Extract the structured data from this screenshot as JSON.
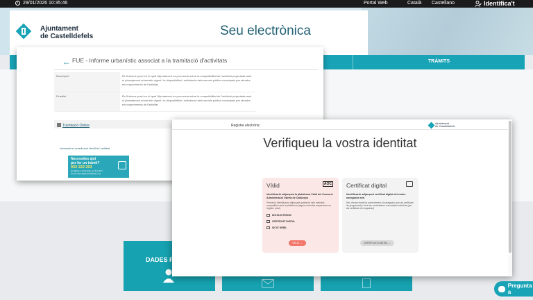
{
  "topbar": {
    "datetime": "29/01/2026 10:35:46",
    "links": [
      "Portal Web",
      "Català",
      "Castellano"
    ],
    "identify": "Identifica't"
  },
  "header": {
    "logo_line1": "Ajuntament",
    "logo_line2": "de Castelldefels",
    "site_title": "Seu electrònica"
  },
  "nav": {
    "tramits": "TRÀMITS"
  },
  "procedure": {
    "title": "FUE - Informe urbanístic associat a la tramitació d'activitats",
    "rows": [
      {
        "key": "Descripció",
        "value": "És l'informe previ en el qual l'Ajuntament es pronuncia sobre la compatibilitat de l'activitat projectada amb el planejament urbanístic vigent i la disponibilitat i suficiència dels serveis públics municipals per atendre els requeriments de l'activitat."
      },
      {
        "key": "Finalitat",
        "value": "És l'informe previ en el qual l'Ajuntament es pronuncia sobre la compatibilitat de l'activitat projectada amb el planejament urbanístic vigent i la disponibilitat i suficiència dels serveis públics municipals per atendre els requeriments de l'activitat."
      }
    ],
    "tramitacio": "Tramitació Online",
    "small_link": "Informació en accedir amb IdentiCat / certificat",
    "banner": {
      "line1": "Necessites ajut",
      "line2": "per fer un tràmit?",
      "phone": "932 222 203",
      "hours": "de dilluns a divendres, de 8 a 20 h",
      "email": "suport.tramits@castelldefels.org"
    }
  },
  "tiles": {
    "dades_personals": "DADES PER"
  },
  "verify": {
    "registre": "Registre electrònic",
    "logo_text1": "Ajuntament",
    "logo_text2": "de Castelldefels",
    "heading": "Verifiqueu la vostra identitat",
    "valid": {
      "title": "Vàlid",
      "badge": "AOC",
      "desc": "Identificació mitjançant la plataforma Vàlid del Consorci Administració Oberta de Catalunya",
      "desc2": "Permet la identificació mitjançant qualsevol dels mètodes compatibles amb la plataforma (alguns mètodes requereixen un registre previ)",
      "options": [
        "DNI ELECTRÒNIC",
        "CERTIFICAT DIGITAL",
        "IDCAT MÒBIL"
      ],
      "button": "VÀLID"
    },
    "cert": {
      "title": "Certificat digital",
      "desc": "Identificació mitjançant certificat digital del vostre navegador web",
      "desc2": "Heu d'estar instal·lat correctament al navegador (per als certificats de programari) o tenir els controladors connectats instal·lats (per als certificats de maquinari)",
      "button": "CERTIFICAT DIGITAL"
    }
  },
  "chat": {
    "label": "Pregunta a"
  }
}
